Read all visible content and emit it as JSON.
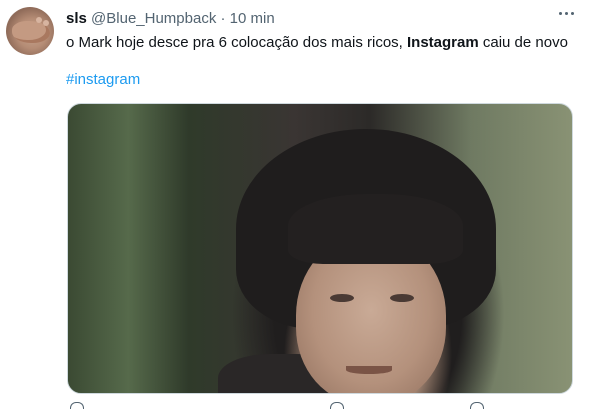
{
  "tweet": {
    "display_name": "sls",
    "handle": "@Blue_Humpback",
    "separator": "·",
    "time": "10 min",
    "text_before": "o Mark hoje desce pra 6 colocação dos mais ricos, ",
    "text_bold": "Instagram",
    "text_after": " caiu de novo",
    "hashtag": "#instagram"
  },
  "icons": {
    "more": "more-options-icon"
  },
  "colors": {
    "text": "#0f1419",
    "secondary": "#536471",
    "link": "#1d9bf0",
    "border": "#cfd9de"
  }
}
